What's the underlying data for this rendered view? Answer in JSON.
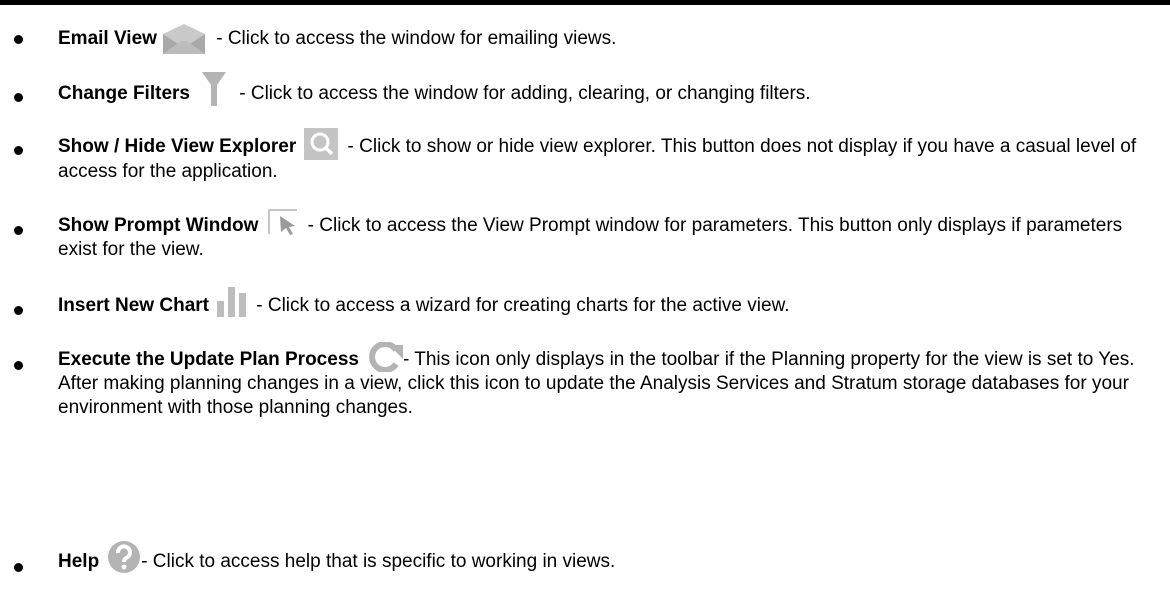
{
  "items": [
    {
      "title": "Email View",
      "icon": "envelope-icon",
      "desc": " - Click to access the window for emailing views."
    },
    {
      "title": "Change Filters",
      "icon": "filter-icon",
      "desc": " - Click to access the window for adding, clearing, or changing filters."
    },
    {
      "title": "Show / Hide View Explorer",
      "icon": "view-explorer-icon",
      "desc": " - Click to show or hide view explorer. This button does not display if you have a casual level of access for the application."
    },
    {
      "title": "Show Prompt Window",
      "icon": "prompt-cursor-icon",
      "desc": " - Click to access the View Prompt window for parameters. This button only displays if parameters exist for the view."
    },
    {
      "title": "Insert New Chart",
      "icon": "bar-chart-icon",
      "desc": " - Click to access a wizard for creating charts for the active view."
    },
    {
      "title": "Execute the Update Plan Process",
      "icon": "refresh-icon",
      "desc": "- This icon only displays in the toolbar if the Planning property for the view is set to Yes. After making planning changes in a view, click this icon to update the Analysis Services and Stratum storage databases for your environment with those planning changes."
    },
    {
      "title": "Help",
      "icon": "help-icon",
      "desc": "- Click to access help that is specific to working in views."
    }
  ],
  "icon_color": "#b4b4b4"
}
